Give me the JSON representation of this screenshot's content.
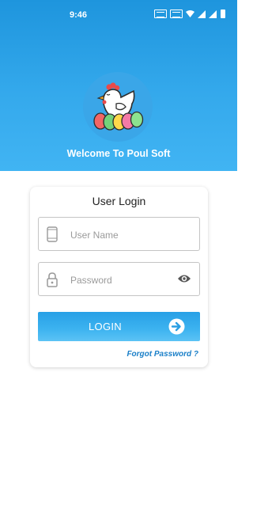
{
  "status": {
    "time": "9:46",
    "icons": [
      "sim1-icon",
      "sim2-icon",
      "wifi-icon",
      "signal-icon",
      "signal-icon",
      "battery-icon"
    ]
  },
  "header": {
    "welcome": "Welcome To Poul Soft"
  },
  "login_card": {
    "title": "User Login",
    "username_placeholder": "User Name",
    "username_value": "",
    "password_placeholder": "Password",
    "password_value": "",
    "login_label": "LOGIN",
    "forgot_label": "Forgot Password ?"
  },
  "colors": {
    "header_gradient_top": "#1e95dd",
    "header_gradient_bottom": "#41b4f3",
    "accent": "#1a7fc8",
    "button": "#36aaeb"
  }
}
